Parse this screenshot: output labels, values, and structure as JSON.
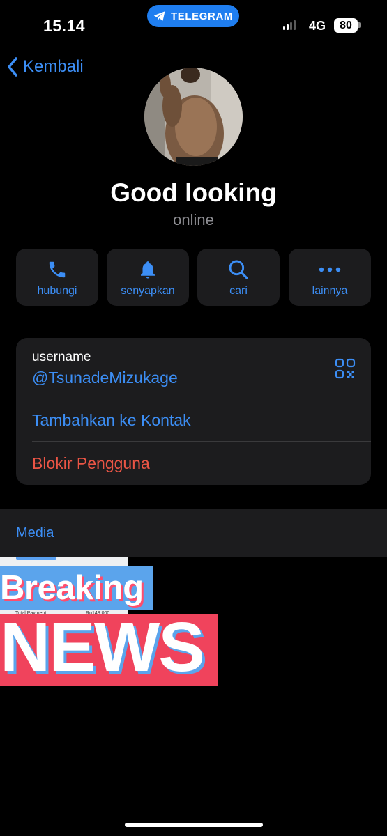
{
  "status_bar": {
    "time": "15.14",
    "app_pill": "TELEGRAM",
    "network": "4G",
    "battery": "80"
  },
  "nav": {
    "back_label": "Kembali"
  },
  "profile": {
    "name": "Good looking",
    "status": "online"
  },
  "actions": [
    {
      "label": "hubungi",
      "icon": "phone-icon"
    },
    {
      "label": "senyapkan",
      "icon": "bell-icon"
    },
    {
      "label": "cari",
      "icon": "search-icon"
    },
    {
      "label": "lainnya",
      "icon": "more-icon"
    }
  ],
  "info": {
    "username_label": "username",
    "username_value": "@TsunadeMizukage",
    "add_contact": "Tambahkan ke Kontak",
    "block_user": "Blokir Pengguna"
  },
  "media": {
    "tab_label": "Media",
    "thumb_row_label": "Total Payment",
    "thumb_row_value": "Rp148.000"
  },
  "overlay": {
    "line1": "Breaking",
    "line2": "NEWS"
  },
  "colors": {
    "accent": "#3c8ef5",
    "danger": "#eb5545",
    "card": "#1c1c1e",
    "background": "#000000",
    "telegram_pill": "#1f7ef0",
    "news_red": "#f0435c",
    "news_blue": "#5ba4ec"
  }
}
